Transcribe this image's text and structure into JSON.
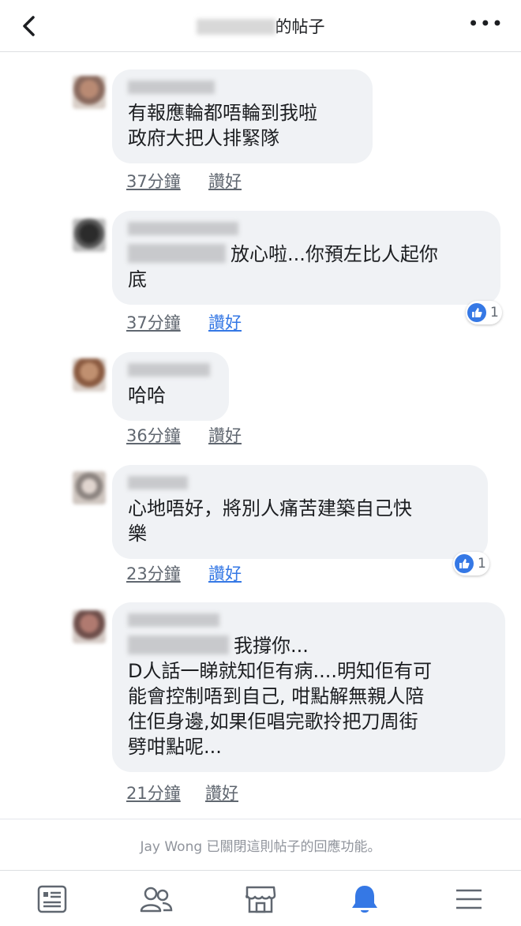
{
  "header": {
    "title_suffix": "的帖子",
    "more_label": "•••"
  },
  "comments": [
    {
      "lines": [
        "有報應輪都唔輪到我啦",
        "政府大把人排緊隊"
      ],
      "time": "37分鐘",
      "like_label": "讚好",
      "liked": false
    },
    {
      "tag_text": "放心啦...你預左比人起你",
      "lines": [
        "底"
      ],
      "time": "37分鐘",
      "like_label": "讚好",
      "liked": true,
      "reaction_count": "1"
    },
    {
      "lines": [
        "哈哈"
      ],
      "time": "36分鐘",
      "like_label": "讚好",
      "liked": false
    },
    {
      "lines": [
        "心地唔好，將別人痛苦建築自己快",
        "樂"
      ],
      "time": "23分鐘",
      "like_label": "讚好",
      "liked": true,
      "reaction_count": "1"
    },
    {
      "tag_text": "我撐你...",
      "lines": [
        "D人話一睇就知佢有病....明知佢有可",
        "能會控制唔到自己, 咁點解無親人陪",
        "住佢身邊,如果佢唱完歌拎把刀周街",
        "劈咁點呢..."
      ],
      "time": "21分鐘",
      "like_label": "讚好",
      "liked": false
    }
  ],
  "footer": {
    "closed_notice": "Jay Wong 已關閉這則帖子的回應功能。"
  },
  "tabbar": {
    "tabs": [
      {
        "icon": "news-feed-icon"
      },
      {
        "icon": "friends-icon"
      },
      {
        "icon": "marketplace-icon"
      },
      {
        "icon": "notifications-bell-icon",
        "active": true
      },
      {
        "icon": "menu-icon"
      }
    ]
  },
  "colors": {
    "accent": "#3578e5",
    "bubble": "#f0f2f5",
    "meta_text": "#606770",
    "notice_text": "#90949c"
  }
}
